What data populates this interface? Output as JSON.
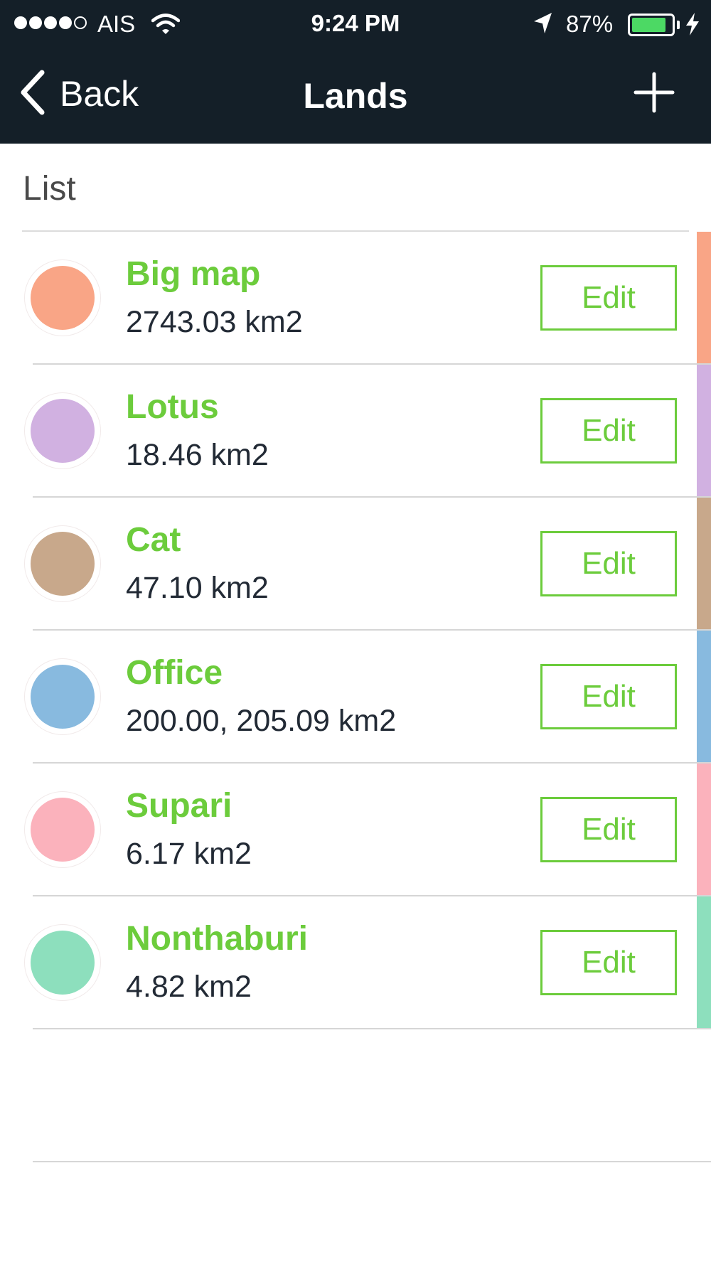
{
  "status_bar": {
    "signal_bars_filled": 4,
    "signal_bars_total": 5,
    "carrier": "AIS",
    "wifi_icon": "wifi-icon",
    "time": "9:24 PM",
    "location_icon": "location-arrow-icon",
    "battery_percent": "87%",
    "battery_level": 0.87,
    "battery_color": "#4cd964",
    "charging_icon": "lightning-bolt-icon"
  },
  "nav": {
    "back_label": "Back",
    "back_icon": "chevron-left-icon",
    "title": "Lands",
    "add_icon": "plus-icon"
  },
  "list": {
    "section_title": "List",
    "edit_label": "Edit",
    "items": [
      {
        "name": "Big map",
        "area": "2743.03 km2",
        "color": "#f9a586"
      },
      {
        "name": "Lotus",
        "area": "18.46 km2",
        "color": "#d1b1e1"
      },
      {
        "name": "Cat",
        "area": "47.10 km2",
        "color": "#c8a88b"
      },
      {
        "name": "Office",
        "area": "200.00, 205.09 km2",
        "color": "#88badf"
      },
      {
        "name": "Supari",
        "area": "6.17 km2",
        "color": "#fbb2bc"
      },
      {
        "name": "Nonthaburi",
        "area": "4.82 km2",
        "color": "#8ddfbd"
      }
    ]
  },
  "colors": {
    "nav_background": "#141f28",
    "accent_green": "#6ccc3c",
    "text_dark": "#222a35"
  }
}
